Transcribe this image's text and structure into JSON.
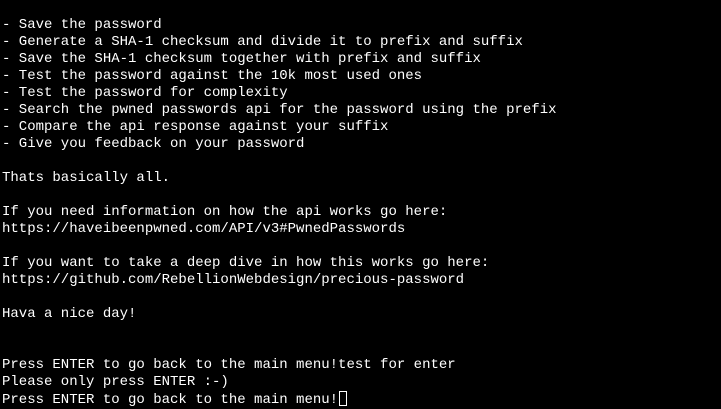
{
  "terminal": {
    "steps": [
      "- Save the password",
      "- Generate a SHA-1 checksum and divide it to prefix and suffix",
      "- Save the SHA-1 checksum together with prefix and suffix",
      "- Test the password against the 10k most used ones",
      "- Test the password for complexity",
      "- Search the pwned passwords api for the password using the prefix",
      "- Compare the api response against your suffix",
      "- Give you feedback on your password"
    ],
    "summary": "Thats basically all.",
    "api_info_text": "If you need information on how the api works go here:",
    "api_info_url": "https://haveibeenpwned.com/API/v3#PwnedPasswords",
    "deep_dive_text": "If you want to take a deep dive in how this works go here:",
    "deep_dive_url": "https://github.com/RebellionWebdesign/precious-password",
    "farewell": "Hava a nice day!",
    "prompt_1": "Press ENTER to go back to the main menu!test for enter",
    "warning": "Please only press ENTER :-)",
    "prompt_2": "Press ENTER to go back to the main menu!"
  },
  "colors": {
    "background": "#000000",
    "text": "#ffffff"
  }
}
